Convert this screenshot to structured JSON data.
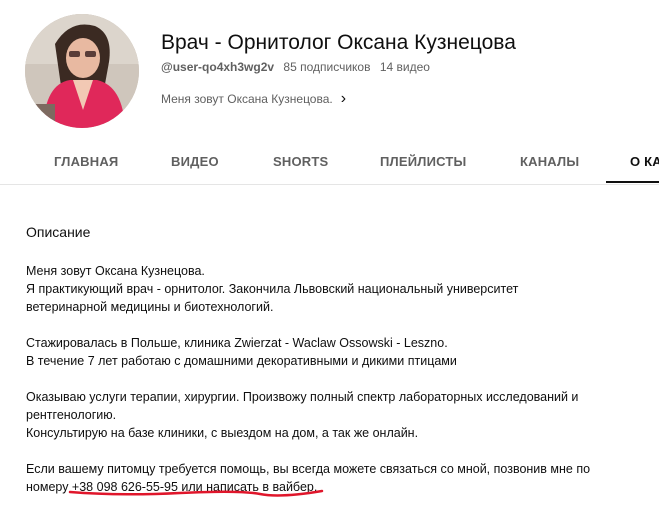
{
  "channel": {
    "title": "Врач - Орнитолог Оксана Кузнецова",
    "handle": "@user-qo4xh3wg2v",
    "subscribers": "85 подписчиков",
    "videos": "14 видео",
    "about_snippet": "Меня зовут Оксана Кузнецова."
  },
  "tabs": [
    {
      "label": "ГЛАВНАЯ"
    },
    {
      "label": "ВИДЕО"
    },
    {
      "label": "SHORTS"
    },
    {
      "label": "ПЛЕЙЛИСТЫ"
    },
    {
      "label": "КАНАЛЫ"
    },
    {
      "label": "О КА"
    }
  ],
  "about": {
    "heading": "Описание",
    "lines": [
      "Меня зовут Оксана Кузнецова.",
      "Я практикующий врач - орнитолог. Закончила Львовский национальный университет",
      "ветеринарной медицины и биотехнологий.",
      "",
      "Стажировалась в Польше, клиника Zwierzat - Waclaw Ossowski - Leszno.",
      "В течение 7 лет работаю с домашними декоративными и дикими птицами",
      "",
      "Оказываю услуги терапии, хирургии. Произвожу полный спектр лабораторных исследований и",
      "рентгенологию.",
      "Консультирую на базе клиники, с выездом на дом, а так же онлайн.",
      "",
      "Если вашему питомцу требуется помощь, вы всегда можете связаться со мной, позвонив мне по",
      "номеру +38 098 626-55-95 или написать в вайбер."
    ]
  },
  "colors": {
    "annotation_red": "#e0162b",
    "muted_text": "#606060"
  }
}
